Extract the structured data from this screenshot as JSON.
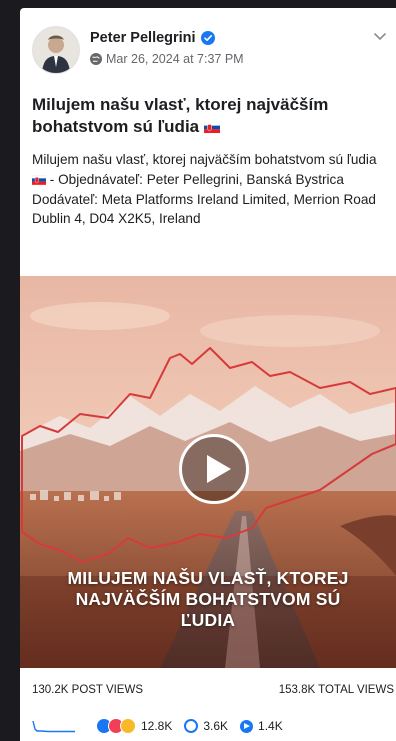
{
  "post": {
    "author": "Peter Pellegrini",
    "timestamp": "Mar 26, 2024 at 7:37 PM",
    "title": "Milujem našu vlasť, ktorej najväčším bohatstvom sú ľudia",
    "body_part1": "Milujem našu vlasť, ktorej najväčším bohatstvom sú ľudia",
    "body_part2": " - Objednávateľ: Peter Pellegrini, Banská Bystrica Dodávateľ: Meta Platforms Ireland Limited, Merrion Road Dublin 4, D04 X2K5, Ireland",
    "video_overlay_line1": "MILUJEM NAŠU VLASŤ, KTOREJ",
    "video_overlay_line2": "NAJVÄČŠÍM BOHATSTVOM SÚ",
    "video_overlay_line3": "ĽUDIA"
  },
  "stats": {
    "post_views": "130.2K POST VIEWS",
    "total_views": "153.8K TOTAL VIEWS"
  },
  "reactions": {
    "reactions_count": "12.8K",
    "comments_count": "3.6K",
    "shares_count": "1.4K"
  },
  "icons": {
    "verified": "verified-badge-icon",
    "globe": "globe-icon",
    "more": "chevron-down-icon",
    "play": "play-icon",
    "flag": "slovakia-flag-icon"
  },
  "colors": {
    "accent": "#1877f2",
    "background": "#1a1a1f",
    "map_outline": "#d63b3b"
  }
}
